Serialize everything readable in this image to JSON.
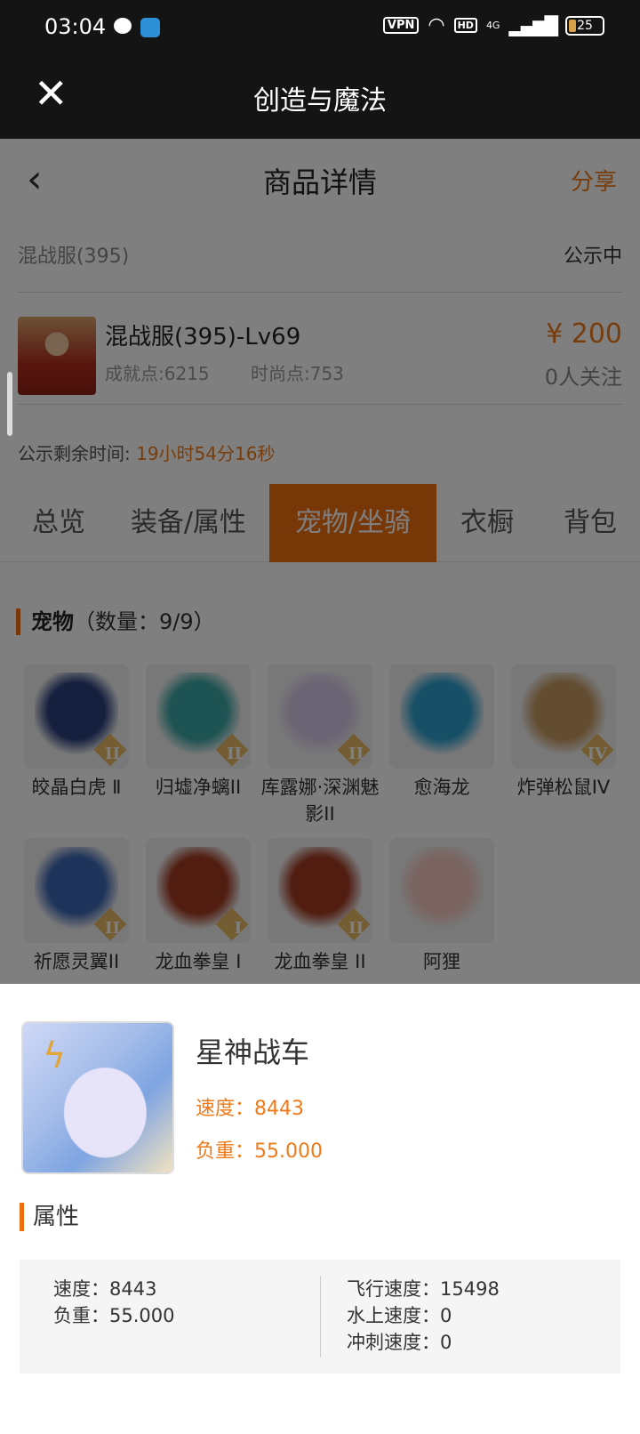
{
  "status_bar": {
    "time": "03:04",
    "vpn": "VPN",
    "hd": "HD",
    "network": "4G",
    "battery": "25"
  },
  "title_bar": {
    "title": "创造与魔法",
    "close": "✕"
  },
  "nav": {
    "back": "‹",
    "title": "商品详情",
    "share": "分享"
  },
  "listing": {
    "server": "混战服(395)",
    "status": "公示中",
    "name": "混战服(395)-Lv69",
    "achievement": "成就点:6215",
    "fashion": "时尚点:753",
    "price": "¥ 200",
    "followers": "0人关注",
    "timer_label": "公示剩余时间: ",
    "timer_value": "19小时54分16秒"
  },
  "tabs": [
    "总览",
    "装备/属性",
    "宠物/坐骑",
    "衣橱",
    "背包"
  ],
  "active_tab": "宠物/坐骑",
  "pets_section": {
    "title": "宠物",
    "count": "（数量：9/9）"
  },
  "pets": [
    {
      "label": "皎晶白虎 Ⅱ",
      "rank": "II",
      "color": "#2b3f7d"
    },
    {
      "label": "归墟净螭II",
      "rank": "II",
      "color": "#3aa6a4"
    },
    {
      "label": "库露娜·深渊魅影II",
      "rank": "II",
      "color": "#d7c9e8"
    },
    {
      "label": "愈海龙",
      "rank": "",
      "color": "#2e9fcf"
    },
    {
      "label": "炸弹松鼠IV",
      "rank": "IV",
      "color": "#c79a61"
    },
    {
      "label": "祈愿灵翼II",
      "rank": "II",
      "color": "#3d68b5"
    },
    {
      "label": "龙血拳皇 I",
      "rank": "I",
      "color": "#a23a22"
    },
    {
      "label": "龙血拳皇 II",
      "rank": "II",
      "color": "#a23a22"
    },
    {
      "label": "阿狸",
      "rank": "",
      "color": "#f3c9c1"
    }
  ],
  "sheet": {
    "mount_name": "星神战车",
    "speed": "速度：8443",
    "load": "负重：55.000",
    "attr_title": "属性",
    "left": [
      "速度：8443",
      "负重：55.000"
    ],
    "right": [
      "飞行速度：15498",
      "水上速度：0",
      "冲刺速度：0"
    ]
  }
}
